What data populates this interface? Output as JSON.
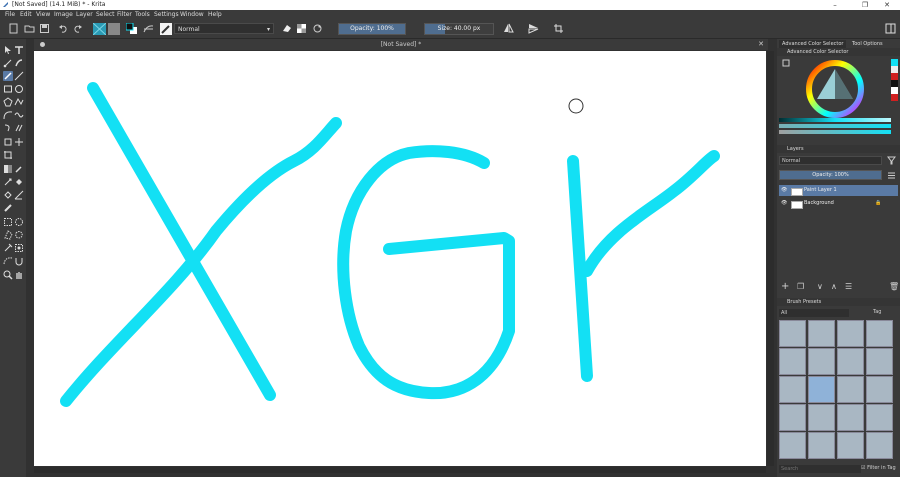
{
  "window": {
    "title": "[Not Saved] (14.1 MiB) * - Krita",
    "controls": [
      "–",
      "❐",
      "✕"
    ]
  },
  "menu": [
    "File",
    "Edit",
    "View",
    "Image",
    "Layer",
    "Select",
    "Filter",
    "Tools",
    "Settings",
    "Window",
    "Help"
  ],
  "toolbar": {
    "blend_mode": "Normal",
    "opacity_label": "Opacity: 100%",
    "opacity_value": 1.0,
    "size_label": "Size: 40.00 px"
  },
  "document": {
    "tab_title": "[Not Saved] *",
    "stroke_color": "#13e0f4"
  },
  "docker": {
    "tabs": [
      "Advanced Color Selector",
      "Tool Options"
    ],
    "color_selector_title": "Advanced Color Selector",
    "layers_title": "Layers",
    "layer_blend_mode": "Normal",
    "layer_opacity_label": "Opacity: 100%",
    "layers": [
      {
        "name": "Paint Layer 1",
        "selected": true
      },
      {
        "name": "Background",
        "selected": false
      }
    ],
    "brush_presets_title": "Brush Presets",
    "brush_filter": "All",
    "tag_label": "Tag",
    "search_placeholder": "Search",
    "filter_in_tag_label": "Filter in Tag"
  },
  "colors": {
    "accent": "#5a7aa5",
    "canvas": "#ffffff",
    "stroke": "#13e0f4"
  }
}
